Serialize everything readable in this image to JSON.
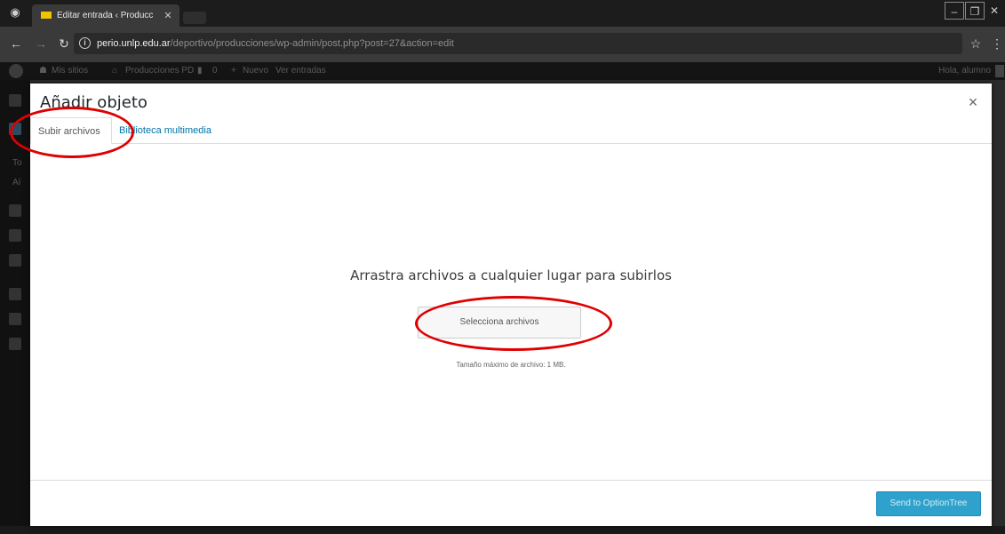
{
  "browser": {
    "tab_title": "Editar entrada ‹ Producc",
    "tab_close": "✕",
    "url_host": "perio.unlp.edu.ar",
    "url_path": "/deportivo/producciones/wp-admin/post.php?post=27&action=edit"
  },
  "adminbar": {
    "mis_sitios": "Mis sitios",
    "site_name": "Producciones PD",
    "comments_count": "0",
    "new_label": "Nuevo",
    "view_posts": "Ver entradas",
    "greeting": "Hola, alumno"
  },
  "sidebar": {
    "text1": "To",
    "text2": "Aí"
  },
  "modal": {
    "title": "Añadir objeto",
    "close_label": "×",
    "tab_upload": "Subir archivos",
    "tab_library": "Biblioteca multimedia",
    "drop_text": "Arrastra archivos a cualquier lugar para subirlos",
    "select_button": "Selecciona archivos",
    "max_size": "Tamaño máximo de archivo: 1 MB.",
    "send_button": "Send to OptionTree"
  },
  "colors": {
    "accent": "#2ea2cc",
    "link": "#0073aa",
    "annotation": "#e00000"
  }
}
